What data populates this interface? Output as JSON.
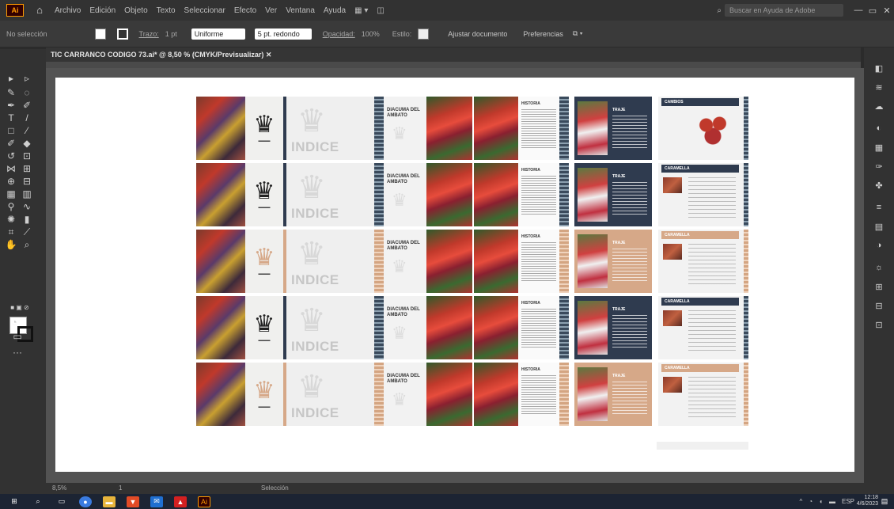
{
  "menubar": {
    "logo": "Ai",
    "home_icon": "home-icon",
    "items": [
      "Archivo",
      "Edición",
      "Objeto",
      "Texto",
      "Seleccionar",
      "Efecto",
      "Ver",
      "Ventana",
      "Ayuda"
    ],
    "search_placeholder": "Buscar en Ayuda de Adobe",
    "window_controls": [
      "—",
      "▭",
      "✕"
    ]
  },
  "controlbar": {
    "selection_label": "No selección",
    "stroke_label": "Trazo:",
    "stroke_value": "1 pt",
    "profile_label": "Uniforme",
    "brush_label": "5 pt. redondo",
    "opacity_label": "Opacidad:",
    "opacity_value": "100%",
    "style_label": "Estilo:",
    "doc_setup": "Ajustar documento",
    "preferences": "Preferencias"
  },
  "document": {
    "tab_title": "TIC CARRANCO CODIGO 73.ai* @ 8,50 % (CMYK/Previsualizar)  ✕"
  },
  "artboard": {
    "rows": [
      {
        "scheme": "navy"
      },
      {
        "scheme": "navy"
      },
      {
        "scheme": "tan"
      },
      {
        "scheme": "navy"
      },
      {
        "scheme": "tan"
      }
    ],
    "indice_text": "INDICE",
    "diablo_title": "DIACUMA DEL AMBATO",
    "historia_title": "HISTORIA",
    "traje_title": "TRAJE",
    "last_titles": [
      "CAMBIOS",
      "CARAMELLA",
      "CARAMELLA",
      "CARAMELLA",
      "CARAMELLA"
    ]
  },
  "statusbar": {
    "zoom": "8,5%",
    "artboard_nav": "1",
    "tool_state": "Selección"
  },
  "taskbar": {
    "clock_time": "12:18",
    "clock_date": "4/6/2023",
    "lang": "ESP"
  },
  "colors": {
    "navy": "#2f3b4f",
    "tan": "#d6a888",
    "accent": "#ff9a00"
  }
}
